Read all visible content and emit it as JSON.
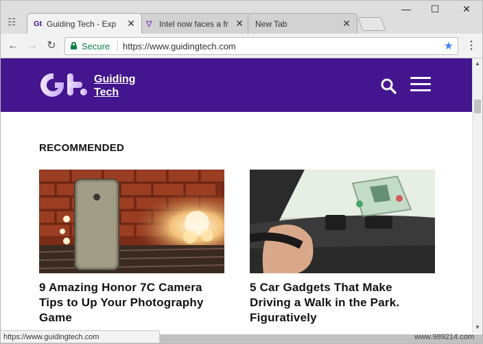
{
  "browser": {
    "tabs": [
      {
        "title": "Guiding Tech - Exp",
        "favicon": "Gt",
        "active": true
      },
      {
        "title": "Intel now faces a fr",
        "favicon": "▽",
        "active": false
      },
      {
        "title": "New Tab",
        "favicon": "",
        "active": false
      }
    ],
    "close_glyph": "✕",
    "controls": {
      "minimize": "—",
      "maximize": "☐",
      "close": "✕"
    },
    "nav": {
      "back": "←",
      "forward": "→",
      "reload": "↻"
    },
    "address": {
      "secure_label": "Secure",
      "url": "https://www.guidingtech.com"
    },
    "star_glyph": "★",
    "menu_glyph": "⋮",
    "status_url": "https://www.guidingtech.com"
  },
  "site": {
    "brand_line1": "Guiding",
    "brand_line2": "Tech",
    "header_color": "#43158e",
    "section_title": "RECOMMENDED",
    "articles": [
      {
        "headline": "9 Amazing Honor 7C Camera Tips to Up Your Photography Game",
        "image": "phone-on-table-with-bokeh-lights"
      },
      {
        "headline": "5 Car Gadgets That Make Driving a Walk in the Park. Figuratively",
        "image": "car-dashboard-heads-up-display"
      }
    ]
  },
  "watermark": "www.989214.com"
}
